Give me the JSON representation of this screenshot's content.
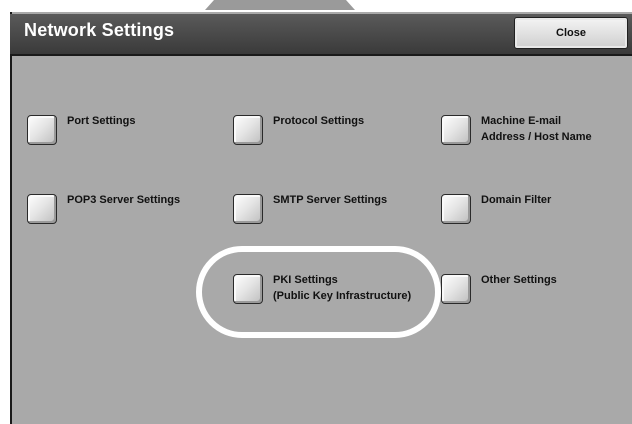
{
  "header": {
    "title": "Network Settings",
    "close_label": "Close"
  },
  "items": [
    {
      "lines": [
        "Port Settings"
      ]
    },
    {
      "lines": [
        "Protocol Settings"
      ]
    },
    {
      "lines": [
        "Machine E-mail",
        "Address / Host Name"
      ]
    },
    {
      "lines": [
        "POP3 Server Settings"
      ]
    },
    {
      "lines": [
        "SMTP Server Settings"
      ]
    },
    {
      "lines": [
        "Domain Filter"
      ]
    },
    {
      "lines": [
        "PKI Settings",
        "(Public Key Infrastructure)"
      ]
    },
    {
      "lines": [
        "Other Settings"
      ]
    }
  ],
  "highlight": {
    "target": "PKI Settings",
    "color": "#ffffff"
  },
  "colors": {
    "panel": "#a9a9a9",
    "header": "#4a4a4a",
    "title_text": "#ffffff"
  }
}
